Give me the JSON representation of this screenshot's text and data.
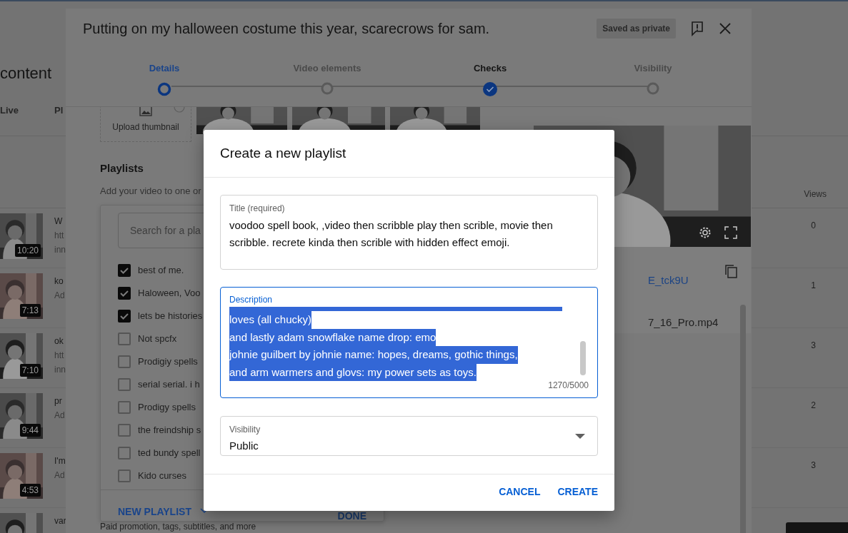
{
  "background_page": {
    "heading": "content",
    "tabs": [
      "Live",
      "Pl"
    ],
    "views_header": "Views",
    "videos": [
      {
        "duration": "10:20",
        "title": "W",
        "lines": [
          "htt",
          "inn"
        ],
        "views": "0"
      },
      {
        "duration": "7:13",
        "title": "ko",
        "lines": [
          "Ad"
        ],
        "views": "1"
      },
      {
        "duration": "7:10",
        "title": "ok",
        "lines": [
          "htt",
          "inn"
        ],
        "views": "3"
      },
      {
        "duration": "9:44",
        "title": "pr",
        "lines": [
          "Ad"
        ],
        "views": "2"
      },
      {
        "duration": "4:53",
        "title": "I'm",
        "lines": [
          "Ad"
        ],
        "views": "3"
      },
      {
        "title": "var"
      }
    ]
  },
  "upload_dialog": {
    "title": "Putting on my halloween costume this year, scarecrows for sam.",
    "save_status": "Saved as private",
    "steps": [
      {
        "label": "Details",
        "selected": true,
        "completed": false
      },
      {
        "label": "Video elements",
        "selected": false,
        "completed": false
      },
      {
        "label": "Checks",
        "selected": false,
        "completed": true
      },
      {
        "label": "Visibility",
        "selected": false,
        "completed": false
      }
    ],
    "thumbnail_upload": "Upload thumbnail",
    "playlists": {
      "heading": "Playlists",
      "hint": "Add your video to one or",
      "search_placeholder": "Search for a pla",
      "items": [
        {
          "label": "best of me.",
          "checked": true
        },
        {
          "label": "Haloween, Voo",
          "checked": true
        },
        {
          "label": "lets be histories",
          "checked": true
        },
        {
          "label": "Not spcfx",
          "checked": false
        },
        {
          "label": "Prodigiy spells",
          "checked": false
        },
        {
          "label": "serial serial. i h",
          "checked": false
        },
        {
          "label": "Prodigy spells",
          "checked": false
        },
        {
          "label": "the freindship s",
          "checked": false
        },
        {
          "label": "ted bundy spell",
          "checked": false
        },
        {
          "label": "Kido curses",
          "checked": false
        }
      ],
      "new_playlist": "NEW PLAYLIST",
      "done": "DONE"
    },
    "more_text": "Paid promotion, tags, subtitles, and more",
    "video_link": "E_tck9U",
    "filename": "7_16_Pro.mp4"
  },
  "create_playlist_dialog": {
    "title": "Create a new playlist",
    "title_field": {
      "label": "Title (required)",
      "value": "voodoo spell book, ,video then scribble play then scrible, movie then scribble. recrete kinda then scrible with hidden effect emoji."
    },
    "description_field": {
      "label": "Description",
      "selected": true,
      "counter": "1270/5000",
      "lines": [
        "loves (all chucky)",
        "and lastly adam snowflake name drop: emo",
        "johnie guilbert by johnie name: hopes, dreams, gothic things,",
        "and arm warmers and glovs: my power sets as toys."
      ]
    },
    "visibility": {
      "label": "Visibility",
      "value": "Public"
    },
    "buttons": [
      "CANCEL",
      "CREATE"
    ]
  }
}
